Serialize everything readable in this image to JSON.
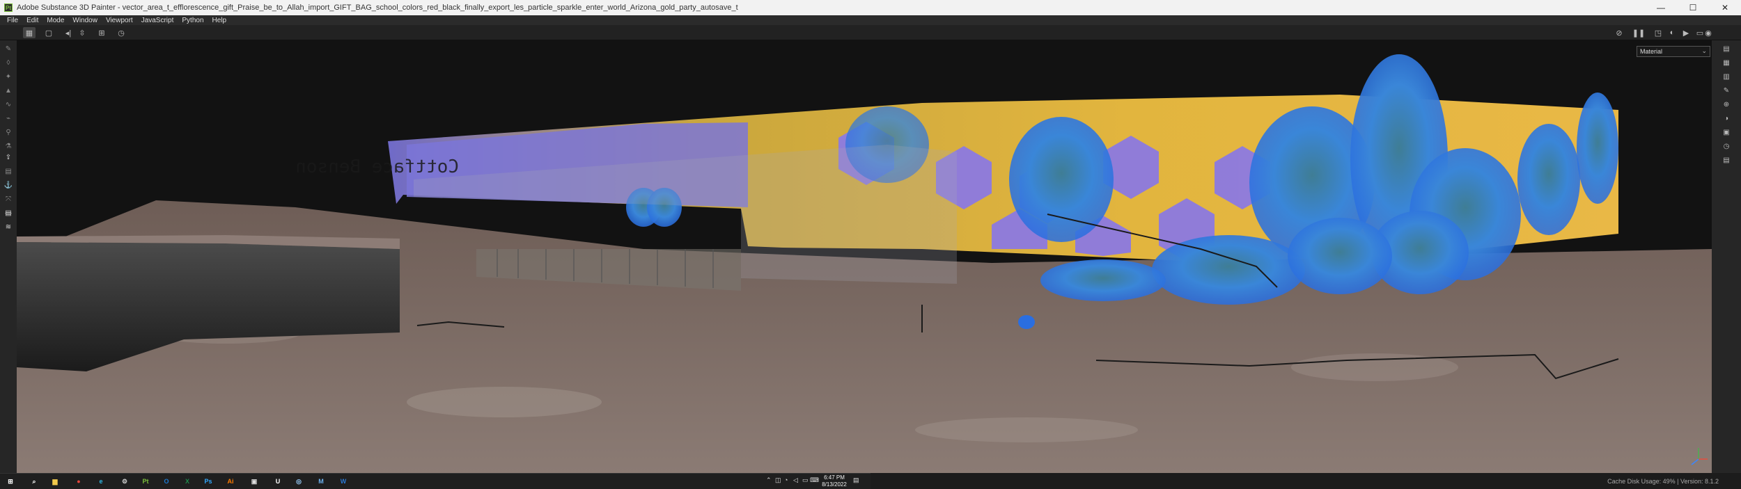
{
  "window": {
    "title": "Adobe Substance 3D Painter - vector_area_t_efflorescence_gift_Praise_be_to_Allah_import_GIFT_BAG_school_colors_red_black_finally_export_les_particle_sparkle_enter_world_Arizona_gold_party_autosave_t",
    "minimize": "—",
    "maximize": "☐",
    "close": "✕"
  },
  "menu": [
    "File",
    "Edit",
    "Mode",
    "Window",
    "Viewport",
    "JavaScript",
    "Python",
    "Help"
  ],
  "viewport": {
    "display_mode": "Material",
    "wall_text": "Cottface Benson"
  },
  "status": {
    "text": "Cache Disk Usage:   49% | Version: 8.1.2"
  },
  "taskbar": {
    "time": "6:47 PM",
    "date": "8/13/2022",
    "apps": [
      {
        "icon": "start-icon",
        "label": "⊞",
        "color": "#ffffff"
      },
      {
        "icon": "search-icon",
        "label": "⌕",
        "color": "#ffffff"
      },
      {
        "icon": "chrome-icon",
        "label": "●",
        "color": "#e8453c"
      },
      {
        "icon": "edge-icon",
        "label": "e",
        "color": "#2fb6e5"
      },
      {
        "icon": "file-explorer-icon",
        "label": "▆",
        "color": "#f2c94c"
      },
      {
        "icon": "settings-icon",
        "label": "⚙",
        "color": "#cccccc"
      },
      {
        "icon": "substance-painter-icon",
        "label": "Pt",
        "color": "#7bbf3a"
      },
      {
        "icon": "outlook-icon",
        "label": "O",
        "color": "#1c7ad4"
      },
      {
        "icon": "excel-icon",
        "label": "X",
        "color": "#1f8a4c"
      },
      {
        "icon": "photoshop-icon",
        "label": "Ps",
        "color": "#31a8ff"
      },
      {
        "icon": "illustrator-icon",
        "label": "Ai",
        "color": "#ff7c00"
      },
      {
        "icon": "capture-icon",
        "label": "▣",
        "color": "#dddddd"
      },
      {
        "icon": "unreal-icon",
        "label": "U",
        "color": "#ffffff"
      },
      {
        "icon": "blender-icon",
        "label": "◎",
        "color": "#9ad0ff"
      },
      {
        "icon": "media-icon",
        "label": "M",
        "color": "#6db3f2"
      },
      {
        "icon": "word-icon",
        "label": "W",
        "color": "#2b78d4"
      }
    ]
  }
}
